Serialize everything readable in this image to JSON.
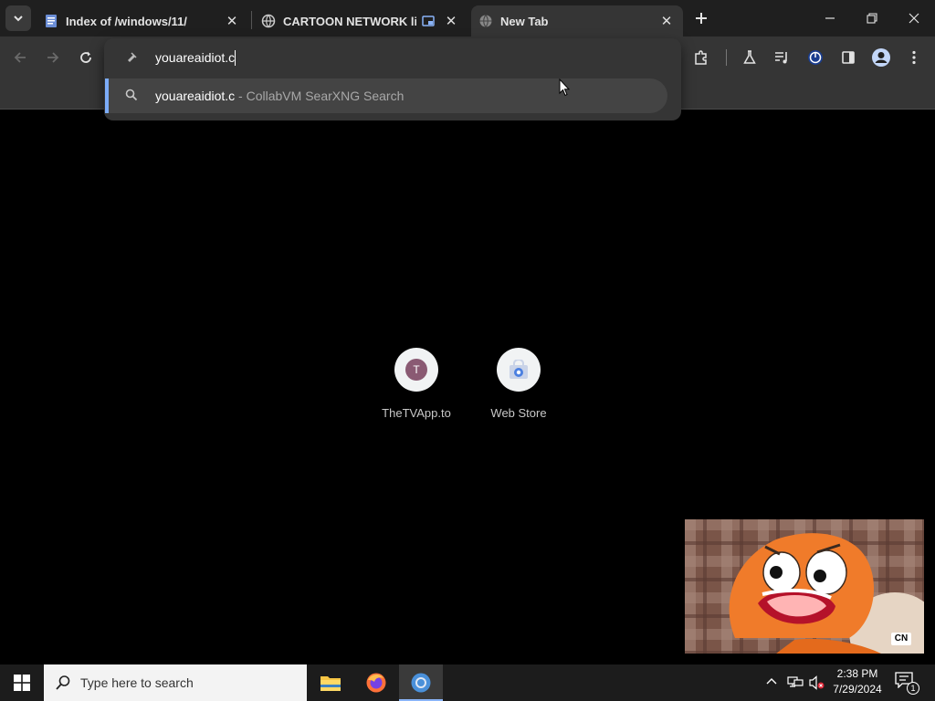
{
  "browser": {
    "tabs": [
      {
        "title": "Index of /windows/11/",
        "active": false
      },
      {
        "title": "CARTOON NETWORK live s",
        "active": false
      },
      {
        "title": "New Tab",
        "active": true
      }
    ],
    "omnibox": {
      "typed_text": "youareaidiot.c",
      "suggestion_query": "youareaidiot.c",
      "suggestion_detail": " - CollabVM SearXNG Search"
    }
  },
  "new_tab": {
    "shortcuts": [
      {
        "label": "TheTVApp.to",
        "letter": "T"
      },
      {
        "label": "Web Store",
        "letter": ""
      }
    ]
  },
  "pip_video": {
    "channel_badge": "CN"
  },
  "taskbar": {
    "search_placeholder": "Type here to search",
    "time": "2:38 PM",
    "date": "7/29/2024",
    "notification_count": "1"
  },
  "colors": {
    "tab_strip": "#1f1f1f",
    "toolbar": "#353535",
    "accent": "#7cacf8",
    "taskbar": "#1c1c1c"
  }
}
